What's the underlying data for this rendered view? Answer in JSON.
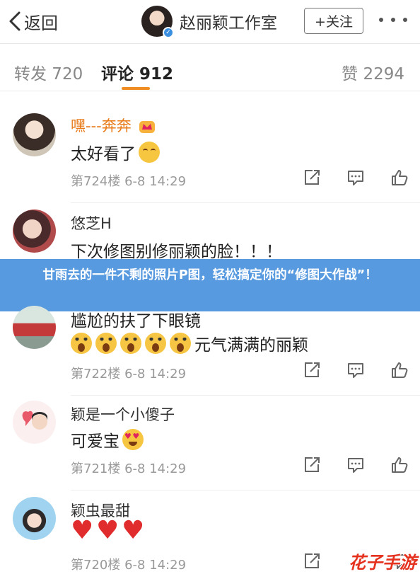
{
  "header": {
    "back_label": "返回",
    "profile_name": "赵丽颖工作室",
    "follow_label": "+关注"
  },
  "tabs": {
    "repost": "转发 720",
    "comment": "评论 912",
    "like": "赞 2294"
  },
  "banner": {
    "text": "甘雨去的一件不剩的照片P图，轻松搞定你的“修图大作战”！"
  },
  "comments": [
    {
      "name": "嘿---奔奔",
      "text": "太好看了",
      "meta": "第724楼  6-8 14:29"
    },
    {
      "name": "悠芝H",
      "text": "下次修图别修丽颖的脸！！！",
      "meta": ""
    },
    {
      "name": "",
      "text": "尴尬的扶了下眼镜",
      "text2": "元气满满的丽颖",
      "meta": "第722楼  6-8 14:29"
    },
    {
      "name": "颖是一个小傻子",
      "text": "可爱宝",
      "meta": "第721楼  6-8 14:29"
    },
    {
      "name": "颖虫最甜",
      "text": "",
      "meta": "第720楼  6-8 14:29"
    }
  ],
  "watermark": "花子手游",
  "colors": {
    "accent": "#f08c24",
    "vip_name": "#e87a18",
    "banner": "#408cdc"
  }
}
